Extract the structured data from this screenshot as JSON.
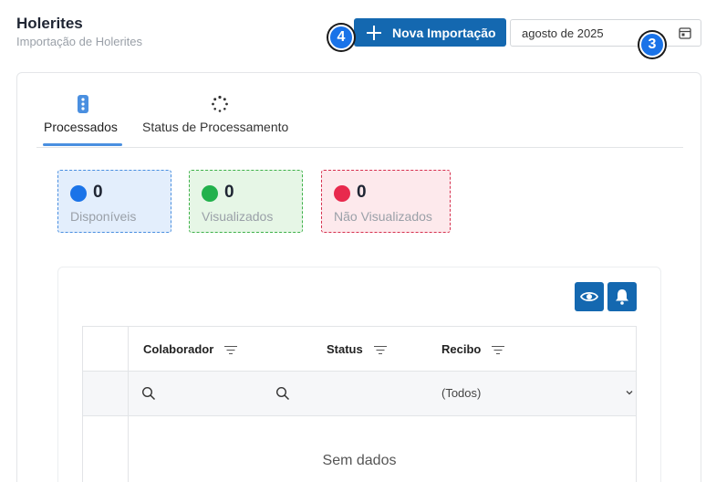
{
  "header": {
    "title": "Holerites",
    "subtitle": "Importação de Holerites",
    "import_button_label": "Nova Importação",
    "date_value": "agosto de 2025"
  },
  "annotations": {
    "badge_import": "4",
    "badge_date": "3"
  },
  "tabs": [
    {
      "label": "Processados",
      "active": true,
      "icon": "list-dots-icon"
    },
    {
      "label": "Status de Processamento",
      "active": false,
      "icon": "spinner-icon"
    }
  ],
  "stats": [
    {
      "count": "0",
      "label": "Disponíveis",
      "color": "#1a73e8"
    },
    {
      "count": "0",
      "label": "Visualizados",
      "color": "#22b14c"
    },
    {
      "count": "0",
      "label": "Não Visualizados",
      "color": "#e8294d"
    }
  ],
  "toolbar": {
    "eye_icon": "eye-icon",
    "bell_icon": "bell-icon"
  },
  "grid": {
    "columns": [
      "Colaborador",
      "Status",
      "Recibo"
    ],
    "recibo_filter_value": "(Todos)",
    "empty_text": "Sem dados"
  },
  "colors": {
    "primary": "#1468b0",
    "active_tab": "#4a8fe0"
  }
}
